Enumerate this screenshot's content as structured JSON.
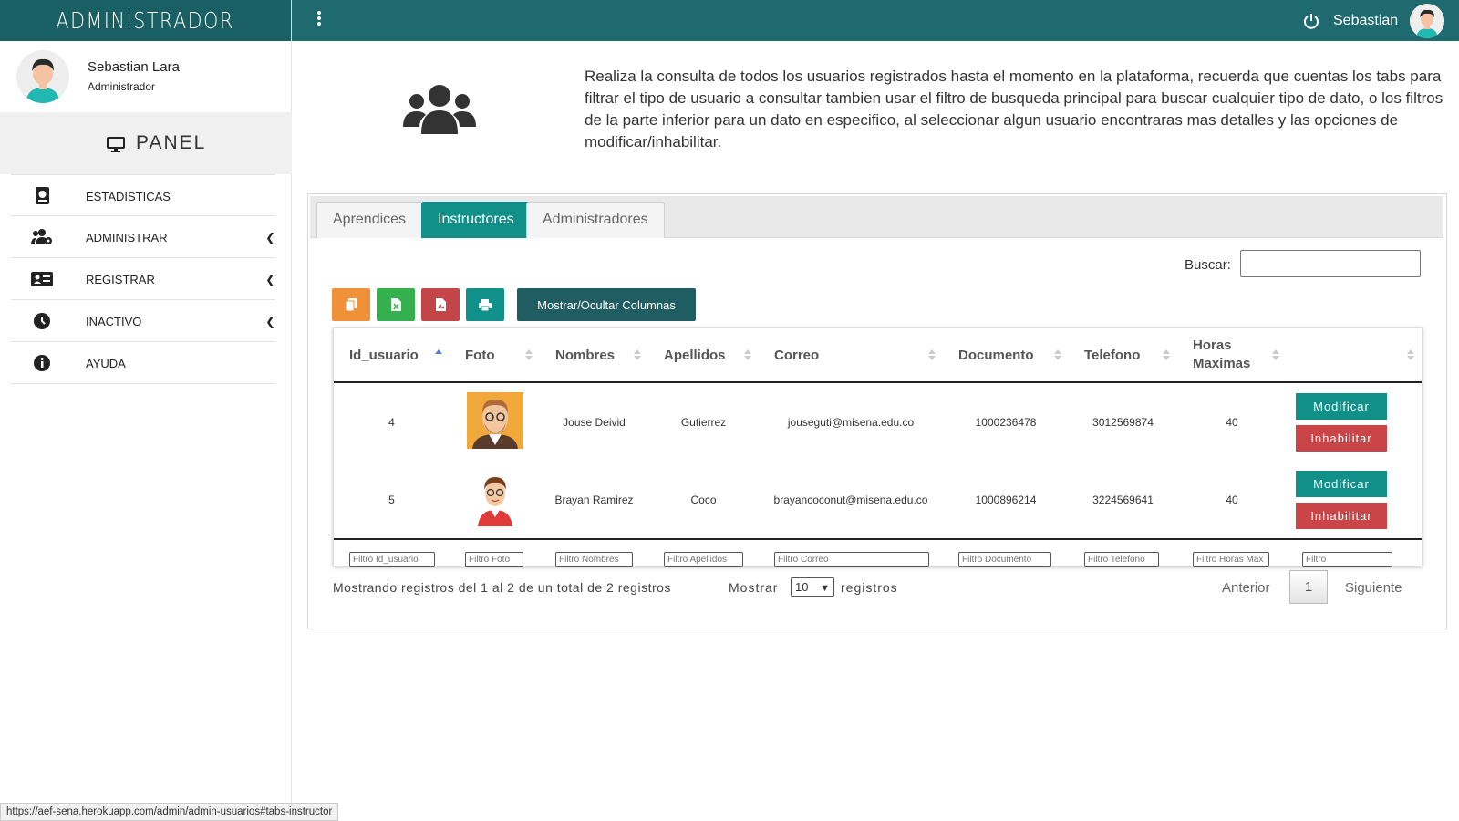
{
  "brand": "ADMINISTRADOR",
  "topbar": {
    "user_name": "Sebastian"
  },
  "sidebar": {
    "profile_name": "Sebastian Lara",
    "profile_role": "Administrador",
    "panel_label": "PANEL",
    "items": [
      {
        "label": "ESTADISTICAS",
        "icon": "stats-book-icon",
        "chevron": false
      },
      {
        "label": "ADMINISTRAR",
        "icon": "users-gear-icon",
        "chevron": true
      },
      {
        "label": "REGISTRAR",
        "icon": "id-card-icon",
        "chevron": true
      },
      {
        "label": "INACTIVO",
        "icon": "inactive-icon",
        "chevron": true
      },
      {
        "label": "AYUDA",
        "icon": "info-icon",
        "chevron": false
      }
    ]
  },
  "intro_text": "Realiza la consulta de todos los usuarios registrados hasta el momento en la plataforma, recuerda que cuentas los tabs para filtrar el tipo de usuario a consultar tambien usar el filtro de busqueda principal para buscar cualquier tipo de dato, o los filtros de la parte inferior para un dato en especifico, al seleccionar algun usuario encontraras mas detalles y las opciones de modificar/inhabilitar.",
  "tabs": [
    {
      "label": "Aprendices",
      "active": false
    },
    {
      "label": "Instructores",
      "active": true
    },
    {
      "label": "Administradores",
      "active": false
    }
  ],
  "search": {
    "label": "Buscar:",
    "value": ""
  },
  "export_buttons": [
    {
      "name": "copy",
      "icon": "copy-icon",
      "color": "#f0913a"
    },
    {
      "name": "excel",
      "icon": "excel-icon",
      "color": "#35b04f"
    },
    {
      "name": "pdf",
      "icon": "pdf-icon",
      "color": "#c44548"
    },
    {
      "name": "print",
      "icon": "print-icon",
      "color": "#11908a"
    }
  ],
  "columns_button": "Mostrar/Ocultar Columnas",
  "table": {
    "headers": [
      "Id_usuario",
      "Foto",
      "Nombres",
      "Apellidos",
      "Correo",
      "Documento",
      "Telefono",
      "Horas Maximas",
      ""
    ],
    "rows": [
      {
        "id": "4",
        "nombres": "Jouse Deivid",
        "apellidos": "Gutierrez",
        "correo": "jouseguti@misena.edu.co",
        "documento": "1000236478",
        "telefono": "3012569874",
        "horas": "40"
      },
      {
        "id": "5",
        "nombres": "Brayan Ramirez",
        "apellidos": "Coco",
        "correo": "brayancoconut@misena.edu.co",
        "documento": "1000896214",
        "telefono": "3224569641",
        "horas": "40"
      }
    ],
    "modify_label": "Modificar",
    "disable_label": "Inhabilitar",
    "filters": [
      "Filtro Id_usuario",
      "Filtro Foto",
      "Filtro Nombres",
      "Filtro Apellidos",
      "Filtro Correo",
      "Filtro Documento",
      "Filtro Telefono",
      "Filtro Horas Max",
      "Filtro"
    ]
  },
  "footer": {
    "info": "Mostrando registros del 1 al 2 de un total de 2 registros",
    "show_label": "Mostrar",
    "page_size": "10",
    "records_label": "registros",
    "prev": "Anterior",
    "page": "1",
    "next": "Siguiente"
  },
  "status_url": "https://aef-sena.herokuapp.com/admin/admin-usuarios#tabs-instructor",
  "colors": {
    "topbar": "#1e6a6e",
    "accent": "#11908a",
    "danger": "#c94547"
  }
}
